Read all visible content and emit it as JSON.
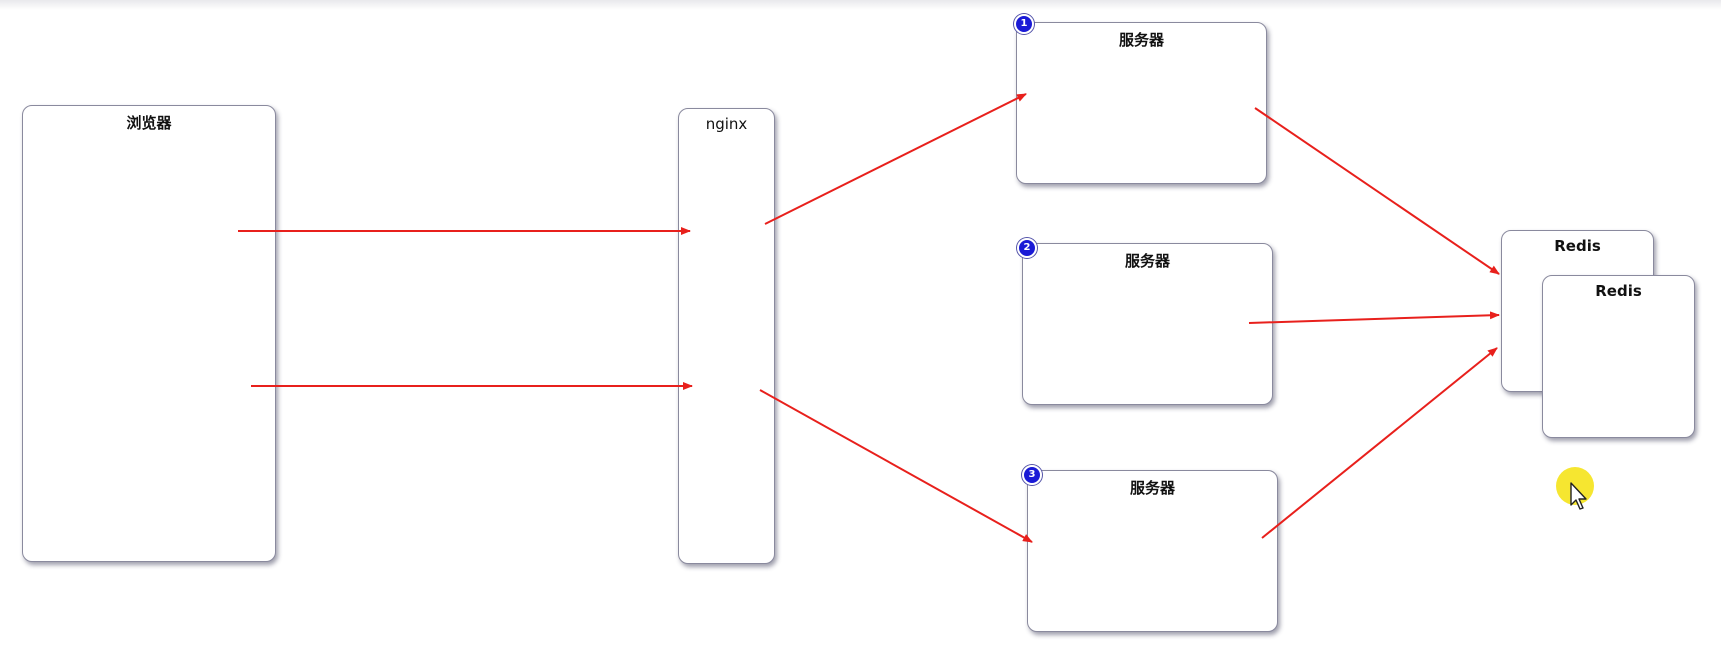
{
  "nodes": {
    "browser": {
      "label": "浏览器"
    },
    "nginx": {
      "label": "nginx"
    },
    "server1": {
      "label": "服务器",
      "badge": "1"
    },
    "server2": {
      "label": "服务器",
      "badge": "2"
    },
    "server3": {
      "label": "服务器",
      "badge": "3"
    },
    "redis_back": {
      "label": "Redis"
    },
    "redis_front": {
      "label": "Redis"
    }
  },
  "colors": {
    "arrow": "#e8201c",
    "badge": "#1a1ad6",
    "cursor_halo": "#f5e31a"
  },
  "icons": {
    "cursor": "mouse-pointer-icon"
  }
}
